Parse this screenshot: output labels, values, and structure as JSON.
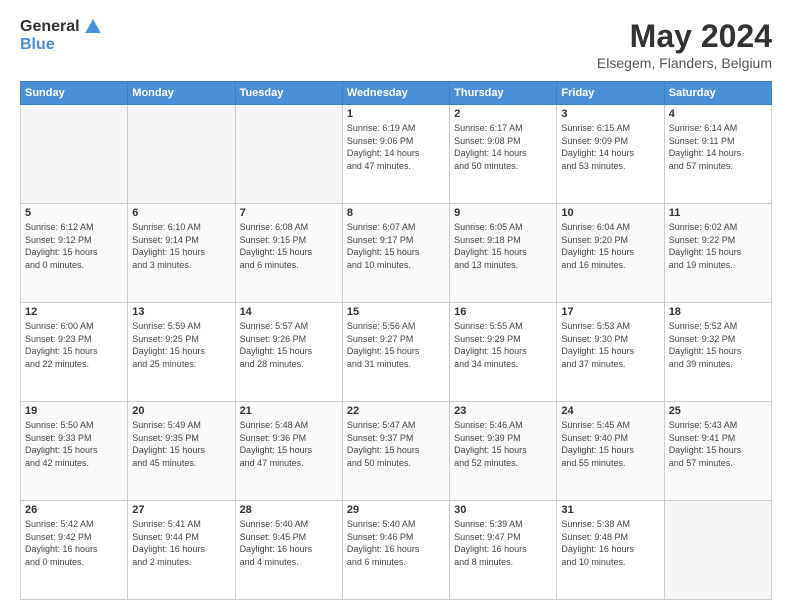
{
  "header": {
    "logo_line1": "General",
    "logo_line2": "Blue",
    "title": "May 2024",
    "subtitle": "Elsegem, Flanders, Belgium"
  },
  "columns": [
    "Sunday",
    "Monday",
    "Tuesday",
    "Wednesday",
    "Thursday",
    "Friday",
    "Saturday"
  ],
  "weeks": [
    [
      {
        "day": "",
        "info": ""
      },
      {
        "day": "",
        "info": ""
      },
      {
        "day": "",
        "info": ""
      },
      {
        "day": "1",
        "info": "Sunrise: 6:19 AM\nSunset: 9:06 PM\nDaylight: 14 hours\nand 47 minutes."
      },
      {
        "day": "2",
        "info": "Sunrise: 6:17 AM\nSunset: 9:08 PM\nDaylight: 14 hours\nand 50 minutes."
      },
      {
        "day": "3",
        "info": "Sunrise: 6:15 AM\nSunset: 9:09 PM\nDaylight: 14 hours\nand 53 minutes."
      },
      {
        "day": "4",
        "info": "Sunrise: 6:14 AM\nSunset: 9:11 PM\nDaylight: 14 hours\nand 57 minutes."
      }
    ],
    [
      {
        "day": "5",
        "info": "Sunrise: 6:12 AM\nSunset: 9:12 PM\nDaylight: 15 hours\nand 0 minutes."
      },
      {
        "day": "6",
        "info": "Sunrise: 6:10 AM\nSunset: 9:14 PM\nDaylight: 15 hours\nand 3 minutes."
      },
      {
        "day": "7",
        "info": "Sunrise: 6:08 AM\nSunset: 9:15 PM\nDaylight: 15 hours\nand 6 minutes."
      },
      {
        "day": "8",
        "info": "Sunrise: 6:07 AM\nSunset: 9:17 PM\nDaylight: 15 hours\nand 10 minutes."
      },
      {
        "day": "9",
        "info": "Sunrise: 6:05 AM\nSunset: 9:18 PM\nDaylight: 15 hours\nand 13 minutes."
      },
      {
        "day": "10",
        "info": "Sunrise: 6:04 AM\nSunset: 9:20 PM\nDaylight: 15 hours\nand 16 minutes."
      },
      {
        "day": "11",
        "info": "Sunrise: 6:02 AM\nSunset: 9:22 PM\nDaylight: 15 hours\nand 19 minutes."
      }
    ],
    [
      {
        "day": "12",
        "info": "Sunrise: 6:00 AM\nSunset: 9:23 PM\nDaylight: 15 hours\nand 22 minutes."
      },
      {
        "day": "13",
        "info": "Sunrise: 5:59 AM\nSunset: 9:25 PM\nDaylight: 15 hours\nand 25 minutes."
      },
      {
        "day": "14",
        "info": "Sunrise: 5:57 AM\nSunset: 9:26 PM\nDaylight: 15 hours\nand 28 minutes."
      },
      {
        "day": "15",
        "info": "Sunrise: 5:56 AM\nSunset: 9:27 PM\nDaylight: 15 hours\nand 31 minutes."
      },
      {
        "day": "16",
        "info": "Sunrise: 5:55 AM\nSunset: 9:29 PM\nDaylight: 15 hours\nand 34 minutes."
      },
      {
        "day": "17",
        "info": "Sunrise: 5:53 AM\nSunset: 9:30 PM\nDaylight: 15 hours\nand 37 minutes."
      },
      {
        "day": "18",
        "info": "Sunrise: 5:52 AM\nSunset: 9:32 PM\nDaylight: 15 hours\nand 39 minutes."
      }
    ],
    [
      {
        "day": "19",
        "info": "Sunrise: 5:50 AM\nSunset: 9:33 PM\nDaylight: 15 hours\nand 42 minutes."
      },
      {
        "day": "20",
        "info": "Sunrise: 5:49 AM\nSunset: 9:35 PM\nDaylight: 15 hours\nand 45 minutes."
      },
      {
        "day": "21",
        "info": "Sunrise: 5:48 AM\nSunset: 9:36 PM\nDaylight: 15 hours\nand 47 minutes."
      },
      {
        "day": "22",
        "info": "Sunrise: 5:47 AM\nSunset: 9:37 PM\nDaylight: 15 hours\nand 50 minutes."
      },
      {
        "day": "23",
        "info": "Sunrise: 5:46 AM\nSunset: 9:39 PM\nDaylight: 15 hours\nand 52 minutes."
      },
      {
        "day": "24",
        "info": "Sunrise: 5:45 AM\nSunset: 9:40 PM\nDaylight: 15 hours\nand 55 minutes."
      },
      {
        "day": "25",
        "info": "Sunrise: 5:43 AM\nSunset: 9:41 PM\nDaylight: 15 hours\nand 57 minutes."
      }
    ],
    [
      {
        "day": "26",
        "info": "Sunrise: 5:42 AM\nSunset: 9:42 PM\nDaylight: 16 hours\nand 0 minutes."
      },
      {
        "day": "27",
        "info": "Sunrise: 5:41 AM\nSunset: 9:44 PM\nDaylight: 16 hours\nand 2 minutes."
      },
      {
        "day": "28",
        "info": "Sunrise: 5:40 AM\nSunset: 9:45 PM\nDaylight: 16 hours\nand 4 minutes."
      },
      {
        "day": "29",
        "info": "Sunrise: 5:40 AM\nSunset: 9:46 PM\nDaylight: 16 hours\nand 6 minutes."
      },
      {
        "day": "30",
        "info": "Sunrise: 5:39 AM\nSunset: 9:47 PM\nDaylight: 16 hours\nand 8 minutes."
      },
      {
        "day": "31",
        "info": "Sunrise: 5:38 AM\nSunset: 9:48 PM\nDaylight: 16 hours\nand 10 minutes."
      },
      {
        "day": "",
        "info": ""
      }
    ]
  ]
}
